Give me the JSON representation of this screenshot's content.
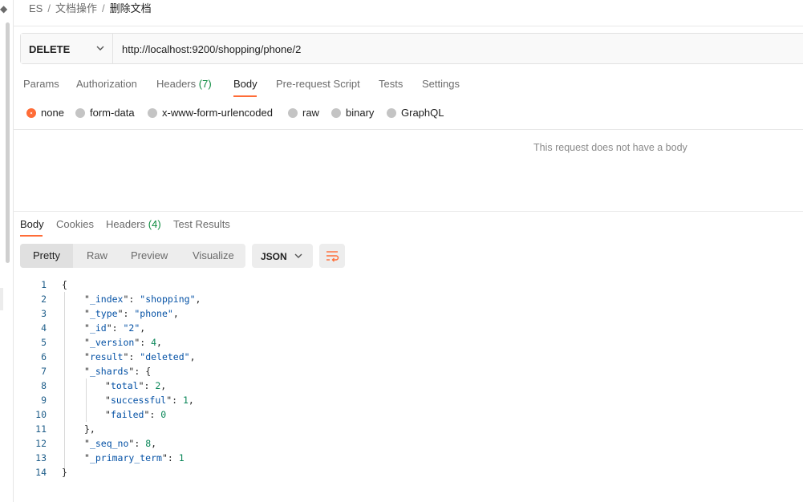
{
  "breadcrumb": {
    "items": [
      "ES",
      "文档操作",
      "删除文档"
    ]
  },
  "request": {
    "method": "DELETE",
    "url": "http://localhost:9200/shopping/phone/2",
    "tabs": [
      {
        "label": "Params"
      },
      {
        "label": "Authorization"
      },
      {
        "label": "Headers",
        "count": "(7)"
      },
      {
        "label": "Body"
      },
      {
        "label": "Pre-request Script"
      },
      {
        "label": "Tests"
      },
      {
        "label": "Settings"
      }
    ],
    "active_tab": "Body",
    "body_modes": [
      "none",
      "form-data",
      "x-www-form-urlencoded",
      "raw",
      "binary",
      "GraphQL"
    ],
    "selected_body_mode": "none",
    "empty_message": "This request does not have a body"
  },
  "response": {
    "tabs": [
      {
        "label": "Body"
      },
      {
        "label": "Cookies"
      },
      {
        "label": "Headers",
        "count": "(4)"
      },
      {
        "label": "Test Results"
      }
    ],
    "active_tab": "Body",
    "view_modes": [
      "Pretty",
      "Raw",
      "Preview",
      "Visualize"
    ],
    "active_view": "Pretty",
    "format": "JSON",
    "lines": [
      {
        "n": "1",
        "text": "{"
      },
      {
        "n": "2",
        "key": "_index",
        "value": "\"shopping\"",
        "trail": ","
      },
      {
        "n": "3",
        "key": "_type",
        "value": "\"phone\"",
        "trail": ","
      },
      {
        "n": "4",
        "key": "_id",
        "value": "\"2\"",
        "trail": ","
      },
      {
        "n": "5",
        "key": "_version",
        "value": "4",
        "trail": ","
      },
      {
        "n": "6",
        "key": "result",
        "value": "\"deleted\"",
        "trail": ","
      },
      {
        "n": "7",
        "key": "_shards",
        "value": "{",
        "trail": ""
      },
      {
        "n": "8",
        "key": "total",
        "value": "2",
        "trail": ","
      },
      {
        "n": "9",
        "key": "successful",
        "value": "1",
        "trail": ","
      },
      {
        "n": "10",
        "key": "failed",
        "value": "0",
        "trail": ""
      },
      {
        "n": "11",
        "text": "},"
      },
      {
        "n": "12",
        "key": "_seq_no",
        "value": "8",
        "trail": ","
      },
      {
        "n": "13",
        "key": "_primary_term",
        "value": "1",
        "trail": ""
      },
      {
        "n": "14",
        "text": "}"
      }
    ]
  },
  "colors": {
    "accent": "#ff6c37",
    "count_green": "#0b8a3e",
    "json_key": "#0451a5",
    "json_number": "#098658"
  },
  "icons": {
    "method_dropdown": "chevron-down-icon",
    "format_dropdown": "chevron-down-icon",
    "wrap": "wrap-lines-icon"
  }
}
